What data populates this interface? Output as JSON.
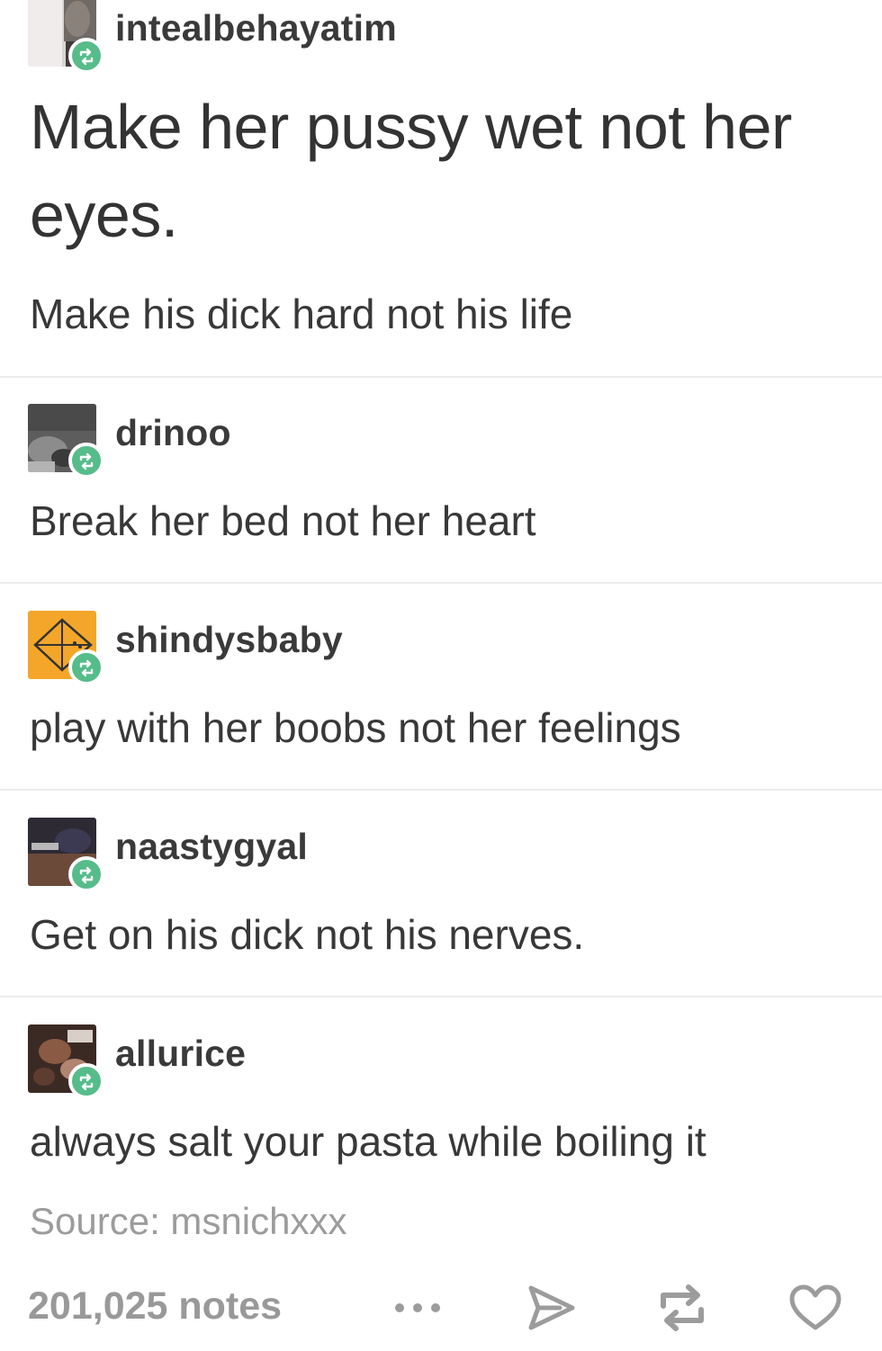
{
  "post": {
    "reblogs": [
      {
        "username": "intealbehayatim",
        "title": "Make her pussy wet not her eyes.",
        "text": "Make his dick hard not his life"
      },
      {
        "username": "drinoo",
        "text": "Break her bed not her heart"
      },
      {
        "username": "shindysbaby",
        "text": "play with her boobs not her feelings"
      },
      {
        "username": "naastygyal",
        "text": "Get on his dick not his nerves."
      },
      {
        "username": "allurice",
        "text": "always salt your pasta while boiling it"
      }
    ],
    "source": {
      "label": "Source:",
      "name": "msnichxxx"
    },
    "notes": "201,025 notes",
    "actions": [
      {
        "name": "more",
        "icon": "more-dots-icon"
      },
      {
        "name": "share",
        "icon": "share-icon"
      },
      {
        "name": "reblog",
        "icon": "reblog-icon"
      },
      {
        "name": "like",
        "icon": "heart-icon"
      }
    ]
  },
  "colors": {
    "reblog_badge": "#56bc8a",
    "text": "#333333",
    "muted": "#999999",
    "divider": "#ececec",
    "shindysbaby_avatar": "#f4a62a"
  }
}
